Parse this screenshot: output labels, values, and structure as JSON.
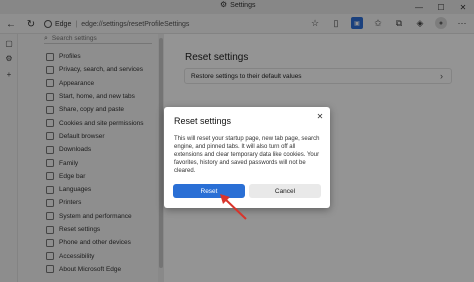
{
  "window": {
    "title": "Settings",
    "controls": [
      "—",
      "☐",
      "✕"
    ]
  },
  "toolbar": {
    "brand": "Edge",
    "separator": "|",
    "url": "edge://settings/resetProfileSettings"
  },
  "sidebar": {
    "search_placeholder": "Search settings",
    "items": [
      {
        "label": "Profiles",
        "icon": "person-icon"
      },
      {
        "label": "Privacy, search, and services",
        "icon": "lock-icon"
      },
      {
        "label": "Appearance",
        "icon": "brush-icon"
      },
      {
        "label": "Start, home, and new tabs",
        "icon": "home-icon"
      },
      {
        "label": "Share, copy and paste",
        "icon": "share-icon"
      },
      {
        "label": "Cookies and site permissions",
        "icon": "cookie-icon"
      },
      {
        "label": "Default browser",
        "icon": "browser-icon"
      },
      {
        "label": "Downloads",
        "icon": "download-icon"
      },
      {
        "label": "Family",
        "icon": "family-icon"
      },
      {
        "label": "Edge bar",
        "icon": "edge-bar-icon"
      },
      {
        "label": "Languages",
        "icon": "language-icon"
      },
      {
        "label": "Printers",
        "icon": "printer-icon"
      },
      {
        "label": "System and performance",
        "icon": "system-icon"
      },
      {
        "label": "Reset settings",
        "icon": "reset-icon"
      },
      {
        "label": "Phone and other devices",
        "icon": "phone-icon"
      },
      {
        "label": "Accessibility",
        "icon": "accessibility-icon"
      },
      {
        "label": "About Microsoft Edge",
        "icon": "edge-logo-icon"
      }
    ]
  },
  "main": {
    "title": "Reset settings",
    "restore_label": "Restore settings to their default values"
  },
  "dialog": {
    "title": "Reset settings",
    "body": "This will reset your startup page, new tab page, search engine, and pinned tabs. It will also turn off all extensions and clear temporary data like cookies. Your favorites, history and saved passwords will not be cleared.",
    "reset_label": "Reset",
    "cancel_label": "Cancel"
  },
  "colors": {
    "accent": "#2a6fd5",
    "annotation_arrow": "#d9342b"
  }
}
